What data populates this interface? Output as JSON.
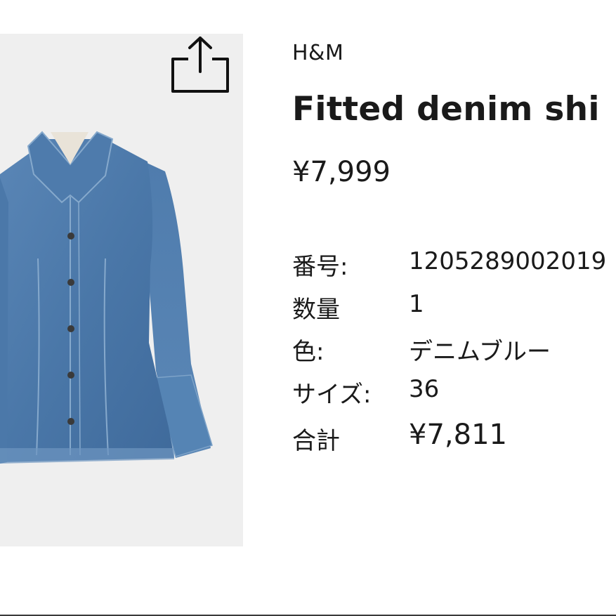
{
  "product": {
    "brand": "H&M",
    "title": "Fitted denim shi",
    "price": "¥7,999"
  },
  "specs": [
    {
      "label": "番号:",
      "value": "1205289002019"
    },
    {
      "label": "数量",
      "value": "1"
    },
    {
      "label": "色:",
      "value": "デニムブルー"
    },
    {
      "label": "サイズ:",
      "value": "36"
    },
    {
      "label": "合計",
      "value": "¥7,811"
    }
  ],
  "icons": {
    "share": "share-icon"
  },
  "colors": {
    "image_background": "#efefef",
    "denim": "#4a77a8",
    "text": "#1a1a1a"
  }
}
